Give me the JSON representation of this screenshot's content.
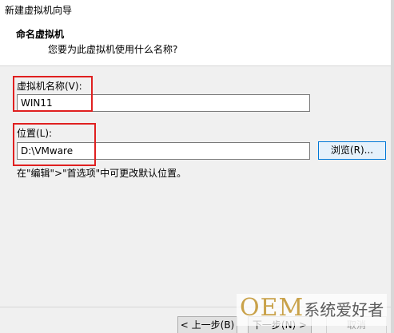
{
  "window": {
    "title": "新建虚拟机向导"
  },
  "header": {
    "title": "命名虚拟机",
    "subtitle": "您要为此虚拟机使用什么名称?"
  },
  "vm_name": {
    "label": "虚拟机名称(V):",
    "value": "WIN11"
  },
  "location": {
    "label": "位置(L):",
    "value": "D:\\VMware",
    "browse_label": "浏览(R)..."
  },
  "hint": "在\"编辑\">\"首选项\"中可更改默认位置。",
  "footer": {
    "back_label": "< 上一步(B)",
    "next_label": "下一步(N) >",
    "cancel_label": "取消"
  },
  "watermark": {
    "brand": "OEM",
    "text": "系统爱好者"
  },
  "colors": {
    "highlight_border": "#e02020",
    "watermark_gold": "#c9a24a",
    "focus_blue": "#0078d7"
  }
}
